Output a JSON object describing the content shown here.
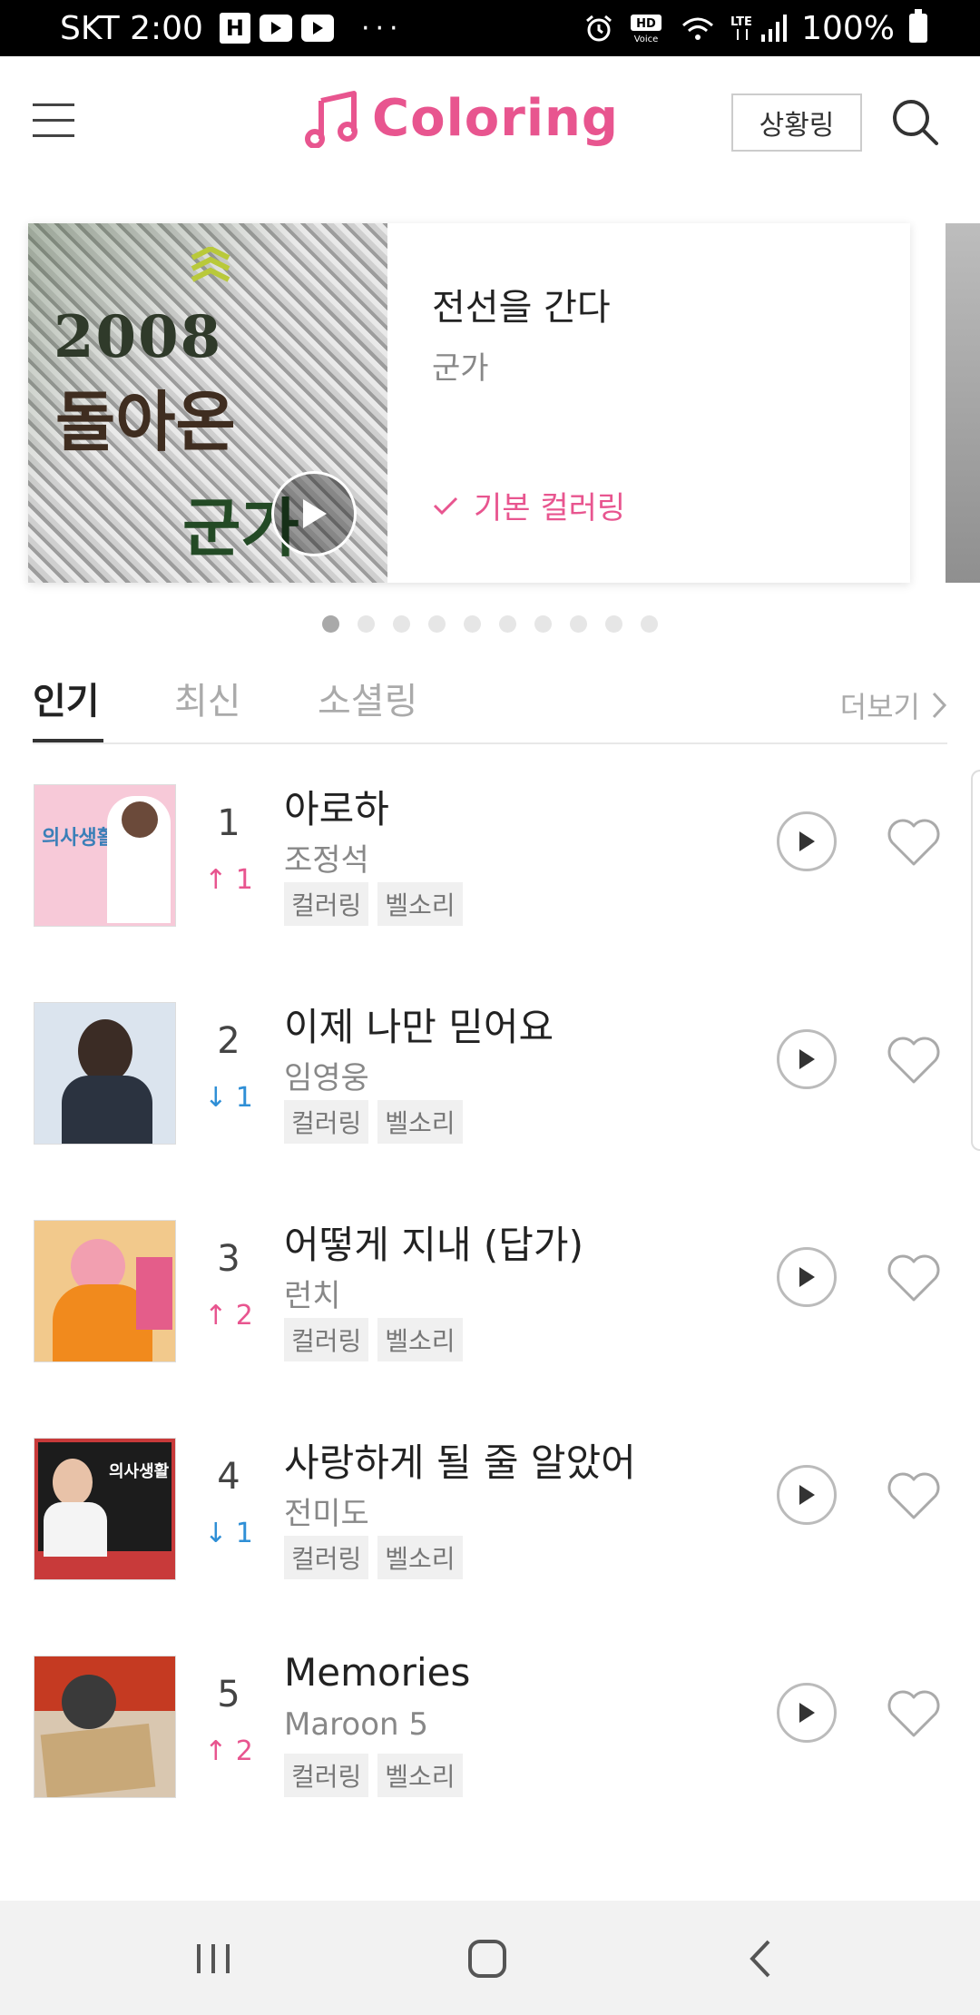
{
  "status_bar": {
    "carrier_time": "SKT 2:00",
    "app_icons": [
      "H",
      "youtube-icon",
      "youtube-icon"
    ],
    "more": "···",
    "right_icons": [
      "alarm-icon",
      "hd-voice-icon",
      "wifi-icon",
      "lte-signal-icon"
    ],
    "battery": "100%"
  },
  "header": {
    "menu_icon": "hamburger-icon",
    "logo_text": "Coloring",
    "logo_icon": "music-note-icon",
    "situation_button": "상황링",
    "search_icon": "search-icon",
    "accent_color": "#e8558f"
  },
  "banner": {
    "art_text_year": "2008",
    "art_text_title": "돌아온",
    "art_text_sub": "군가",
    "title": "전선을 간다",
    "artist": "군가",
    "default_label": "기본 컬러링",
    "check_icon": "check-icon",
    "play_icon": "play-icon",
    "page_count": 10,
    "active_page": 1
  },
  "tabs": [
    {
      "label": "인기",
      "active": true
    },
    {
      "label": "최신",
      "active": false
    },
    {
      "label": "소셜링",
      "active": false
    }
  ],
  "more_label": "더보기",
  "chart": [
    {
      "rank": "1",
      "delta_dir": "up",
      "delta_val": "1",
      "title": "아로하",
      "artist": "조정석",
      "tags": [
        "컬러링",
        "벨소리"
      ],
      "cover_bg": "#f7c9d8",
      "cover_text": "의사생활"
    },
    {
      "rank": "2",
      "delta_dir": "down",
      "delta_val": "1",
      "title": "이제 나만 믿어요",
      "artist": "임영웅",
      "tags": [
        "컬러링",
        "벨소리"
      ],
      "cover_bg": "#dbe4ee",
      "cover_text": ""
    },
    {
      "rank": "3",
      "delta_dir": "up",
      "delta_val": "2",
      "title": "어떻게 지내 (답가)",
      "artist": "런치",
      "tags": [
        "컬러링",
        "벨소리"
      ],
      "cover_bg": "#f2c98c",
      "cover_text": ""
    },
    {
      "rank": "4",
      "delta_dir": "down",
      "delta_val": "1",
      "title": "사랑하게 될 줄 알았어",
      "artist": "전미도",
      "tags": [
        "컬러링",
        "벨소리"
      ],
      "cover_bg": "#c83a3a",
      "cover_text": "의사생활"
    },
    {
      "rank": "5",
      "delta_dir": "up",
      "delta_val": "2",
      "title": "Memories",
      "artist": "Maroon 5",
      "tags": [
        "컬러링",
        "벨소리"
      ],
      "cover_bg": "#d9c7b0",
      "cover_text": ""
    }
  ],
  "nav": [
    "recent-apps-icon",
    "home-icon",
    "back-icon"
  ]
}
